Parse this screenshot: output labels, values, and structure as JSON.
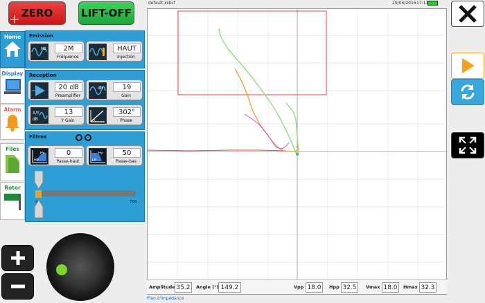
{
  "top_buttons": {
    "zero": "ZERO",
    "liftoff": "LIFT-OFF"
  },
  "tabs": [
    {
      "label": "Home",
      "icon": "home-icon"
    },
    {
      "label": "Display",
      "icon": "monitor-icon"
    },
    {
      "label": "Alarm",
      "icon": "bell-icon"
    },
    {
      "label": "Files",
      "icon": "folder-icon"
    },
    {
      "label": "Rotor",
      "icon": "flag-icon"
    }
  ],
  "emission": {
    "title": "Emission",
    "frequency": {
      "value": "2M",
      "label": "Fréquence"
    },
    "injection": {
      "value": "HAUT",
      "label": "Injection"
    }
  },
  "reception": {
    "title": "Reception",
    "preamplifier": {
      "value": "20 dB",
      "label": "Preamplifier"
    },
    "gain": {
      "value": "19",
      "label": "Gain"
    },
    "y_gain": {
      "value": "13",
      "label": "Y Gain"
    },
    "phase": {
      "value": "302°",
      "label": "Phase"
    }
  },
  "filters": {
    "title": "Filtres",
    "highpass": {
      "value": "0",
      "label": "Passe-haut"
    },
    "lowpass": {
      "value": "50",
      "label": "Passe-bas"
    },
    "slider_min": "0",
    "slider_max": "700",
    "slider_value": 0
  },
  "status": {
    "file": "default.xsbcf",
    "date": "29/04/2016",
    "time": "17:11"
  },
  "measures": {
    "amplitude_label": "Amplitude",
    "amplitude": "35.2",
    "angle_label": "Angle (°)",
    "angle": "149.2",
    "vpp_label": "Vpp",
    "vpp": "18.0",
    "hpp_label": "Hpp",
    "hpp": "32.5",
    "vmax_label": "Vmax",
    "vmax": "18.0",
    "hmax_label": "Hmax",
    "hmax": "32.3"
  },
  "plan_label": "Plan d'impédance",
  "colors": {
    "zero": "#e02828",
    "liftoff": "#2bbd4a",
    "panel": "#2e9ed6",
    "play": "#f7a21b",
    "refresh": "#3aa6dd"
  },
  "right_buttons": [
    "close-icon",
    "play-icon",
    "refresh-icon",
    "fullscreen-icon"
  ]
}
